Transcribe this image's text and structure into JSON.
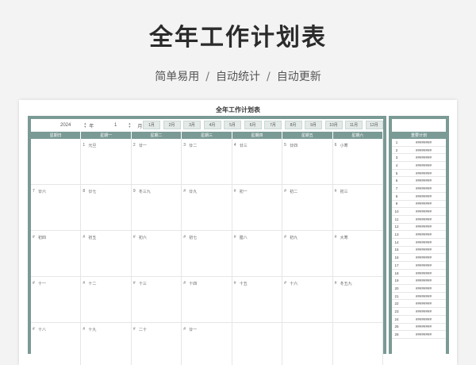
{
  "hero": {
    "title": "全年工作计划表",
    "features": [
      "简单易用",
      "自动统计",
      "自动更新"
    ],
    "separator": "/"
  },
  "sheet": {
    "title": "全年工作计划表",
    "year_value": "2024",
    "year_unit": "年",
    "month_value": "1",
    "month_unit": "月",
    "month_buttons": [
      "1月",
      "2月",
      "3月",
      "4月",
      "5月",
      "6月",
      "7月",
      "8月",
      "9月",
      "10月",
      "11月",
      "12月"
    ],
    "weekdays": [
      "星期日",
      "星期一",
      "星期二",
      "星期三",
      "星期四",
      "星期五",
      "星期六"
    ],
    "weeks": [
      [
        {
          "d": "",
          "l": ""
        },
        {
          "d": "1",
          "l": "元旦"
        },
        {
          "d": "2",
          "l": "廿一"
        },
        {
          "d": "3",
          "l": "廿二"
        },
        {
          "d": "4",
          "l": "廿三"
        },
        {
          "d": "5",
          "l": "廿四"
        },
        {
          "d": "6",
          "l": "小寒"
        }
      ],
      [
        {
          "d": "7",
          "l": "廿六"
        },
        {
          "d": "8",
          "l": "廿七"
        },
        {
          "d": "9",
          "l": "冬三九"
        },
        {
          "d": "#",
          "l": "廿九"
        },
        {
          "d": "#",
          "l": "初一"
        },
        {
          "d": "#",
          "l": "初二"
        },
        {
          "d": "#",
          "l": "初三"
        }
      ],
      [
        {
          "d": "#",
          "l": "初四"
        },
        {
          "d": "#",
          "l": "初五"
        },
        {
          "d": "#",
          "l": "初六"
        },
        {
          "d": "#",
          "l": "初七"
        },
        {
          "d": "#",
          "l": "腊八"
        },
        {
          "d": "#",
          "l": "初九"
        },
        {
          "d": "#",
          "l": "大寒"
        }
      ],
      [
        {
          "d": "#",
          "l": "十一"
        },
        {
          "d": "#",
          "l": "十二"
        },
        {
          "d": "#",
          "l": "十三"
        },
        {
          "d": "#",
          "l": "十四"
        },
        {
          "d": "#",
          "l": "十五"
        },
        {
          "d": "#",
          "l": "十六"
        },
        {
          "d": "#",
          "l": "冬五九"
        }
      ],
      [
        {
          "d": "#",
          "l": "十八"
        },
        {
          "d": "#",
          "l": "十九"
        },
        {
          "d": "#",
          "l": "二十"
        },
        {
          "d": "#",
          "l": "廿一"
        },
        {
          "d": "",
          "l": ""
        },
        {
          "d": "",
          "l": ""
        },
        {
          "d": "",
          "l": ""
        }
      ]
    ],
    "side_title": "重要计划",
    "side_value": "########",
    "side_rows": [
      "1",
      "2",
      "3",
      "4",
      "5",
      "6",
      "7",
      "8",
      "9",
      "10",
      "11",
      "12",
      "13",
      "14",
      "15",
      "16",
      "17",
      "18",
      "19",
      "20",
      "21",
      "22",
      "23",
      "24",
      "25",
      "26"
    ]
  }
}
